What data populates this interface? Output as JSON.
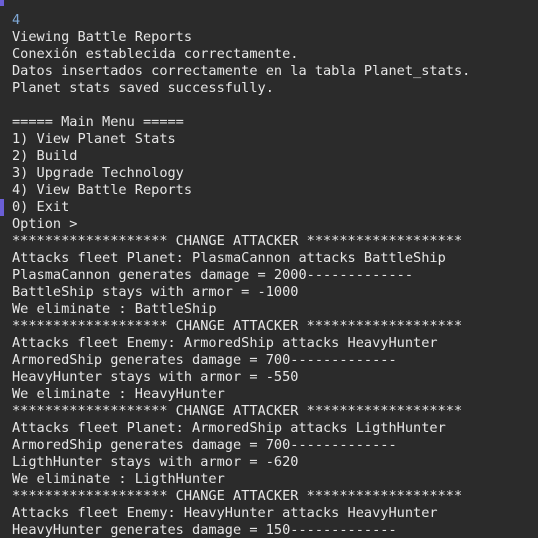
{
  "console": {
    "colors": {
      "background": "#2b2b2b",
      "text": "#e6e6e6",
      "echo_text": "#7fa8d6",
      "gutter_marker": "#6b5fd6"
    },
    "lines": [
      "4",
      "Viewing Battle Reports",
      "Conexión establecida correctamente.",
      "Datos insertados correctamente en la tabla Planet_stats.",
      "Planet stats saved successfully.",
      "",
      "===== Main Menu =====",
      "1) View Planet Stats",
      "2) Build",
      "3) Upgrade Technology",
      "4) View Battle Reports",
      "0) Exit",
      "Option >",
      "******************* CHANGE ATTACKER *******************",
      "Attacks fleet Planet: PlasmaCannon attacks BattleShip",
      "PlasmaCannon generates damage = 2000-------------",
      "BattleShip stays with armor = -1000",
      "We eliminate : BattleShip",
      "******************* CHANGE ATTACKER *******************",
      "Attacks fleet Enemy: ArmoredShip attacks HeavyHunter",
      "ArmoredShip generates damage = 700-------------",
      "HeavyHunter stays with armor = -550",
      "We eliminate : HeavyHunter",
      "******************* CHANGE ATTACKER *******************",
      "Attacks fleet Planet: ArmoredShip attacks LigthHunter",
      "ArmoredShip generates damage = 700-------------",
      "LigthHunter stays with armor = -620",
      "We eliminate : LigthHunter",
      "******************* CHANGE ATTACKER *******************",
      "Attacks fleet Enemy: HeavyHunter attacks HeavyHunter",
      "HeavyHunter generates damage = 150-------------"
    ]
  }
}
